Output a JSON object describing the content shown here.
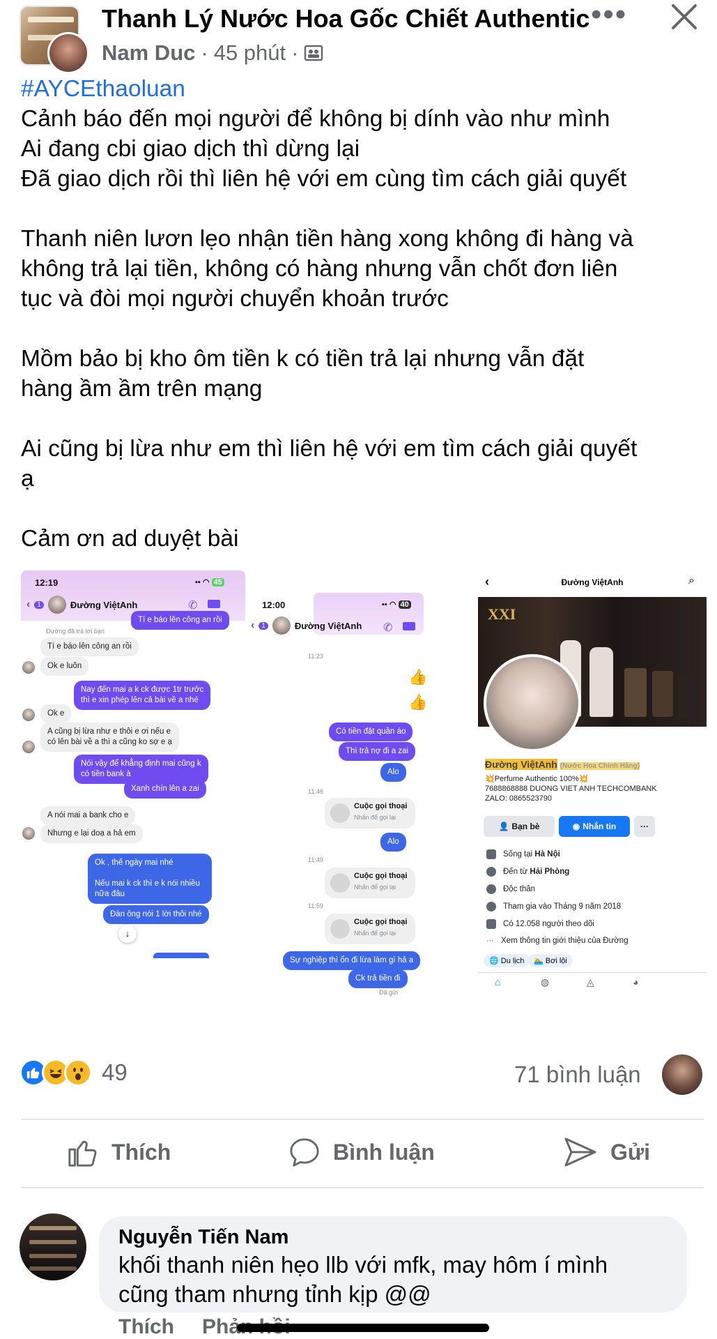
{
  "header": {
    "group_title": "Thanh Lý Nước Hoa Gốc Chiết Authentic",
    "author": "Nam Duc",
    "time": "45 phút",
    "separator": "·",
    "more_icon": "more-horizontal-icon",
    "close_icon": "close-icon",
    "privacy_icon": "group-privacy-icon"
  },
  "post": {
    "hashtag": "#AYCEthaoluan",
    "lines": [
      "Cảnh báo đến mọi người để không bị dính vào như mình",
      "Ai đang cbi giao dịch thì dừng lại",
      "Đã giao dịch rồi thì liên hệ với em cùng tìm cách giải quyết",
      "",
      "Thanh niên lươn lẹo nhận tiền hàng xong không đi hàng và\nkhông trả lại tiền, không có hàng nhưng vẫn chốt đơn liên\ntục và đòi mọi người chuyển khoản trước",
      "",
      "Mồm bảo bị kho ôm tiền k có tiền trả lại nhưng vẫn đặt\nhàng ầm ầm trên mạng",
      "",
      "Ai cũng bị lừa như em thì liên hệ với em tìm cách giải quyết\nạ",
      "",
      "Cảm ơn ad duyệt bài"
    ]
  },
  "shot1": {
    "time": "12:19",
    "battery": "45",
    "back_badge": "1",
    "name": "Đường ViệtAnh",
    "reply_note": "Đường đã trả lời bạn",
    "messages": [
      "Tí e báo lên công an rồi",
      "Tí e báo lên công an rồi",
      "Ok e luôn",
      "Nay đến mai a k ck được 1tr trước\nthì e xin phép lên cả bài về a nhé",
      "Ok e",
      "A cũng bị lừa như e thôi e ơi nếu e\ncó lên bài về a thì a cũng ko sợ e ạ",
      "Nói vậy để khẳng định mai cũng k\ncó tiền bank à",
      "Xanh chín lên a zai",
      "A nói mai a bank cho e",
      "Nhưng e lại doạ a hả em",
      "Ok , thế ngày mai nhé\n\nNếu mai k ck thì e k nói nhiều\nnữa đâu",
      "Đàn ông nói 1 lời thôi nhé"
    ],
    "down_arrow": "↓"
  },
  "shot2": {
    "time": "12:00",
    "battery": "40",
    "back_badge": "1",
    "name": "Đường ViệtAnh",
    "times": [
      "11:23",
      "11:46",
      "11:49",
      "11:59"
    ],
    "messages": [
      "Có tiền đặt quần áo",
      "Thì trả nợ đi a zai",
      "Alo",
      "Alo",
      "Sự nghiệp thì ổn đi lừa làm gì hả a",
      "Ck trả tiền đi"
    ],
    "call_title": "Cuộc gọi thoại",
    "call_sub": "Nhấn để gọi lại",
    "seen": "Đã gửi"
  },
  "shot3": {
    "title": "Đường ViệtAnh",
    "name_line": "Đường ViệtAnh",
    "name_suffix": "(Nước Hoa Chính Hãng)",
    "bio_1": "💥Perfume Authentic 100%💥",
    "bio_2": "7688868888 DUONG VIET ANH TECHCOMBANK",
    "bio_3": "ZALO: 0865523790",
    "btn_friends": "Bạn bè",
    "btn_message": "Nhắn tin",
    "btn_more": "···",
    "info": [
      {
        "label": "Sống tại ",
        "bold": "Hà Nội"
      },
      {
        "label": "Đến từ ",
        "bold": "Hải Phòng"
      },
      {
        "label": "Độc thân",
        "bold": ""
      },
      {
        "label": "Tham gia vào Tháng 9 năm 2018",
        "bold": ""
      },
      {
        "label": "Có 12.058 người theo dõi",
        "bold": ""
      },
      {
        "label": "Xem thông tin giới thiệu của Đường",
        "bold": ""
      }
    ],
    "chip_1": "Du lịch",
    "chip_2": "Bơi lội",
    "cover_text": "XXI"
  },
  "reactions": {
    "count": "49",
    "comments": "71 bình luận",
    "icons": [
      "like-reaction-icon",
      "haha-reaction-icon",
      "wow-reaction-icon"
    ]
  },
  "actions": {
    "like": "Thích",
    "comment": "Bình luận",
    "send": "Gửi"
  },
  "comment": {
    "name": "Nguyễn Tiến Nam",
    "text": "khối thanh niên hẹo llb với mfk, may hôm í mình\ncũng tham nhưng tỉnh kịp @@",
    "like": "Thích",
    "reply": "Phản hồi"
  },
  "colors": {
    "hashtag": "#216fdb",
    "meta_grey": "#65676b",
    "messenger_purple": "#6f4cf0",
    "messenger_blue": "#3d67e6",
    "fb_blue": "#1877f2"
  }
}
